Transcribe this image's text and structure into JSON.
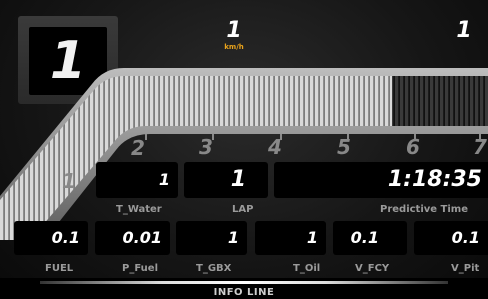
{
  "gear": {
    "value": "1"
  },
  "speed": {
    "value": "1",
    "unit": "km/h"
  },
  "top_right": {
    "value": "1"
  },
  "rpm_scale": {
    "marks": [
      "1",
      "2",
      "3",
      "4",
      "5",
      "6",
      "7"
    ]
  },
  "row1": {
    "t_water": {
      "value": "1",
      "label": "T_Water"
    },
    "lap": {
      "value": "1",
      "label": "LAP"
    },
    "predictive_time": {
      "value": "1:18:35",
      "label": "Predictive Time"
    }
  },
  "row2": [
    {
      "value": "0.1",
      "label": "FUEL"
    },
    {
      "value": "0.01",
      "label": "P_Fuel"
    },
    {
      "value": "1",
      "label": "T_GBX"
    },
    {
      "value": "1",
      "label": "T_Oil"
    },
    {
      "value": "0.1",
      "label": "V_FCY"
    },
    {
      "value": "0.1",
      "label": "V_Pit"
    }
  ],
  "info_line": {
    "label": "INFO LINE"
  },
  "colors": {
    "speed_unit": "#e8a21b",
    "background": "#161616"
  }
}
